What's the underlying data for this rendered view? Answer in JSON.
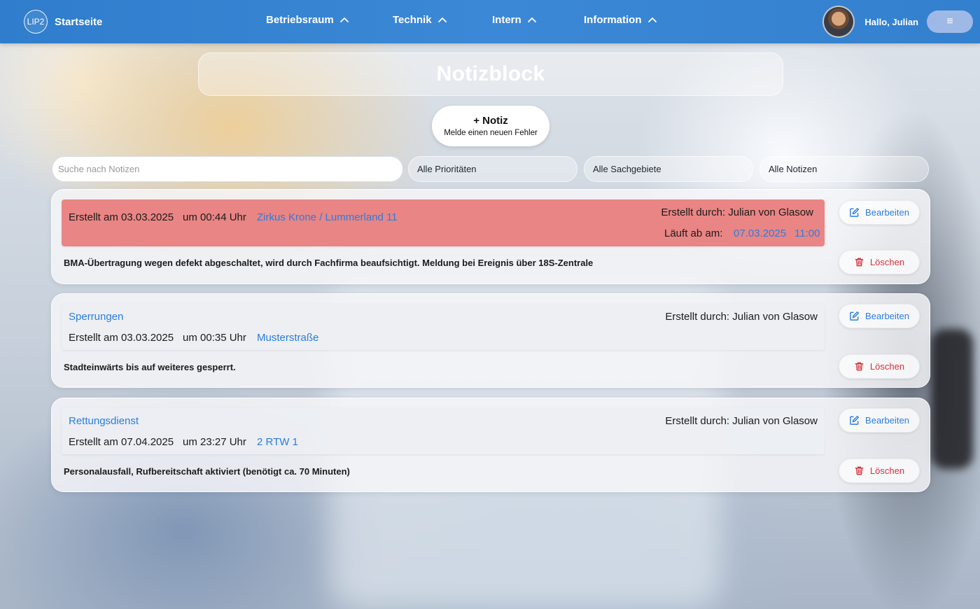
{
  "navbar": {
    "logo_text": "LIP2",
    "brand": "Startseite",
    "items": [
      {
        "label": "Betriebsraum"
      },
      {
        "label": "Technik"
      },
      {
        "label": "Intern"
      },
      {
        "label": "Information"
      }
    ],
    "greeting": "Hallo, Julian",
    "menu_icon": "≡"
  },
  "page": {
    "title": "Notizblock",
    "new_note": {
      "title": "+ Notiz",
      "subtitle": "Melde einen neuen Fehler"
    }
  },
  "filters": {
    "search_placeholder": "Suche nach Notizen",
    "priority": "Alle Prioritäten",
    "subject": "Alle Sachgebiete",
    "notes": "Alle Notizen"
  },
  "notes": [
    {
      "highlight": "red",
      "created": "Erstellt am 03.03.2025",
      "time": "um 00:44 Uhr",
      "location": "Zirkus Krone / Lummerland 11",
      "author": "Erstellt durch: Julian von Glasow",
      "expires_label": "Läuft ab am:",
      "expires_date": "07.03.2025",
      "expires_time": "11:00",
      "text": "BMA-Übertragung wegen defekt abgeschaltet, wird durch Fachfirma beaufsichtigt. Meldung bei Ereignis über 18S-Zentrale",
      "edit_label": "Bearbeiten",
      "delete_label": "Löschen"
    },
    {
      "category": "Sperrungen",
      "created": "Erstellt am 03.03.2025",
      "time": "um 00:35 Uhr",
      "location": "Musterstraße",
      "author": "Erstellt durch: Julian von Glasow",
      "text": "Stadteinwärts bis auf weiteres gesperrt.",
      "edit_label": "Bearbeiten",
      "delete_label": "Löschen"
    },
    {
      "category": "Rettungsdienst",
      "created": "Erstellt am 07.04.2025",
      "time": "um 23:27 Uhr",
      "location": "2 RTW 1",
      "author": "Erstellt durch: Julian von Glasow",
      "text": "Personalausfall, Rufbereitschaft aktiviert (benötigt ca. 70 Minuten)",
      "edit_label": "Bearbeiten",
      "delete_label": "Löschen"
    }
  ],
  "colors": {
    "navbar": "#3b88d6",
    "accent_blue": "#2a7de1",
    "alert_red": "#e98584",
    "delete_red": "#d9303a"
  }
}
